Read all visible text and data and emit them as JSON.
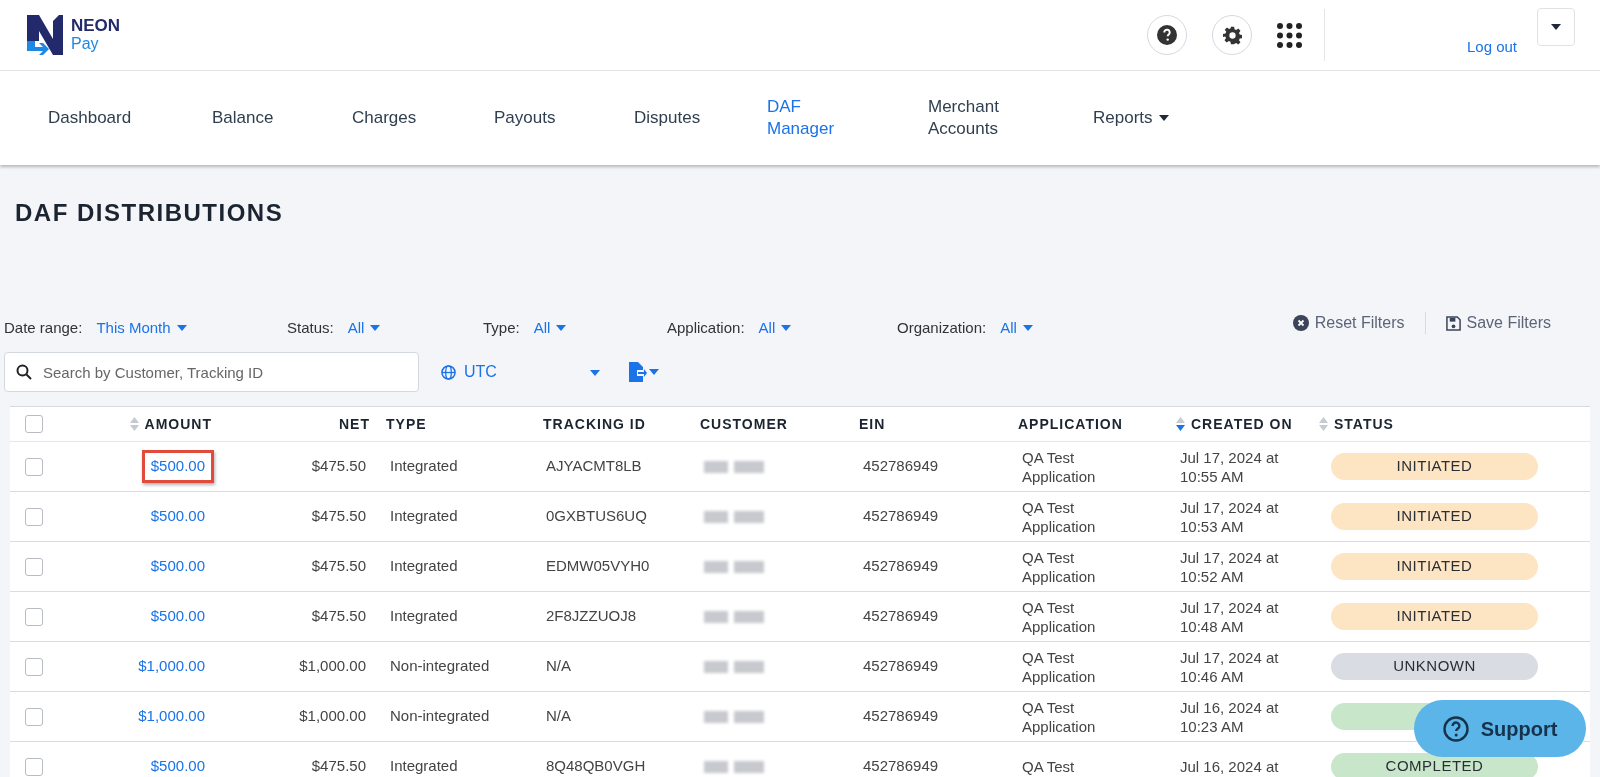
{
  "logo": {
    "brand": "NEON",
    "product": "Pay"
  },
  "header": {
    "logout": "Log out"
  },
  "nav": [
    {
      "label": "Dashboard",
      "selected": false,
      "menu": false
    },
    {
      "label": "Balance",
      "selected": false,
      "menu": false
    },
    {
      "label": "Charges",
      "selected": false,
      "menu": false
    },
    {
      "label": "Payouts",
      "selected": false,
      "menu": false
    },
    {
      "label": "Disputes",
      "selected": false,
      "menu": false
    },
    {
      "label": "DAF Manager",
      "selected": true,
      "menu": false
    },
    {
      "label": "Merchant Accounts",
      "selected": false,
      "menu": false
    },
    {
      "label": "Reports",
      "selected": false,
      "menu": true
    }
  ],
  "page_title": "DAF DISTRIBUTIONS",
  "filters": [
    {
      "label": "Date range:",
      "value": "This Month"
    },
    {
      "label": "Status:",
      "value": "All"
    },
    {
      "label": "Type:",
      "value": "All"
    },
    {
      "label": "Application:",
      "value": "All"
    },
    {
      "label": "Organization:",
      "value": "All"
    }
  ],
  "filter_actions": [
    {
      "kind": "reset",
      "label": "Reset Filters"
    },
    {
      "kind": "save",
      "label": "Save Filters"
    }
  ],
  "search": {
    "placeholder": "Search by Customer, Tracking ID"
  },
  "timezone": "UTC",
  "table": {
    "all_checked": false,
    "columns": [
      {
        "label": "AMOUNT",
        "sortable": true,
        "sorted": false
      },
      {
        "label": "NET",
        "sortable": false
      },
      {
        "label": "TYPE",
        "sortable": false
      },
      {
        "label": "TRACKING ID",
        "sortable": false
      },
      {
        "label": "CUSTOMER",
        "sortable": false
      },
      {
        "label": "EIN",
        "sortable": false
      },
      {
        "label": "APPLICATION",
        "sortable": false
      },
      {
        "label": "CREATED ON",
        "sortable": true,
        "sorted": true
      },
      {
        "label": "STATUS",
        "sortable": true,
        "sorted": false
      }
    ],
    "rows": [
      {
        "checked": false,
        "highlighted": true,
        "amount": "$500.00",
        "net": "$475.50",
        "type": "Integrated",
        "tracking_id": "AJYACMT8LB",
        "ein": "452786949",
        "application": [
          "QA Test",
          "Application"
        ],
        "created_on": [
          "Jul 17, 2024 at",
          "10:55 AM"
        ],
        "status": {
          "label": "INITIATED",
          "color": "#fde4c2"
        }
      },
      {
        "checked": false,
        "highlighted": false,
        "amount": "$500.00",
        "net": "$475.50",
        "type": "Integrated",
        "tracking_id": "0GXBTUS6UQ",
        "ein": "452786949",
        "application": [
          "QA Test",
          "Application"
        ],
        "created_on": [
          "Jul 17, 2024 at",
          "10:53 AM"
        ],
        "status": {
          "label": "INITIATED",
          "color": "#fde4c2"
        }
      },
      {
        "checked": false,
        "highlighted": false,
        "amount": "$500.00",
        "net": "$475.50",
        "type": "Integrated",
        "tracking_id": "EDMW05VYH0",
        "ein": "452786949",
        "application": [
          "QA Test",
          "Application"
        ],
        "created_on": [
          "Jul 17, 2024 at",
          "10:52 AM"
        ],
        "status": {
          "label": "INITIATED",
          "color": "#fde4c2"
        }
      },
      {
        "checked": false,
        "highlighted": false,
        "amount": "$500.00",
        "net": "$475.50",
        "type": "Integrated",
        "tracking_id": "2F8JZZUOJ8",
        "ein": "452786949",
        "application": [
          "QA Test",
          "Application"
        ],
        "created_on": [
          "Jul 17, 2024 at",
          "10:48 AM"
        ],
        "status": {
          "label": "INITIATED",
          "color": "#fde4c2"
        }
      },
      {
        "checked": false,
        "highlighted": false,
        "amount": "$1,000.00",
        "net": "$1,000.00",
        "type": "Non-integrated",
        "tracking_id": "N/A",
        "ein": "452786949",
        "application": [
          "QA Test",
          "Application"
        ],
        "created_on": [
          "Jul 17, 2024 at",
          "10:46 AM"
        ],
        "status": {
          "label": "UNKNOWN",
          "color": "#d9dce3"
        }
      },
      {
        "checked": false,
        "highlighted": false,
        "amount": "$1,000.00",
        "net": "$1,000.00",
        "type": "Non-integrated",
        "tracking_id": "N/A",
        "ein": "452786949",
        "application": [
          "QA Test",
          "Application"
        ],
        "created_on": [
          "Jul 16, 2024 at",
          "10:23 AM"
        ],
        "status": {
          "color": "#c8e6c9"
        }
      },
      {
        "checked": false,
        "highlighted": false,
        "amount": "$500.00",
        "net": "$475.50",
        "type": "Integrated",
        "tracking_id": "8Q48QB0VGH",
        "ein": "452786949",
        "application": [
          "QA Test"
        ],
        "created_on": [
          "Jul 16, 2024 at"
        ],
        "status": {
          "label": "COMPLETED",
          "color": "#c8e6c9"
        }
      }
    ]
  },
  "support": {
    "label": "Support"
  }
}
